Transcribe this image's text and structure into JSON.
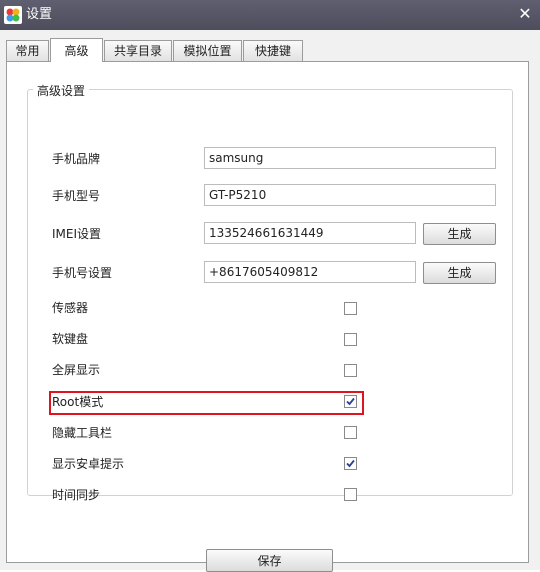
{
  "window": {
    "title": "设置"
  },
  "tabs": [
    {
      "label": "常用"
    },
    {
      "label": "高级"
    },
    {
      "label": "共享目录"
    },
    {
      "label": "模拟位置"
    },
    {
      "label": "快捷键"
    }
  ],
  "advanced": {
    "group_title": "高级设置",
    "brand": {
      "label": "手机品牌",
      "value": "samsung"
    },
    "model": {
      "label": "手机型号",
      "value": "GT-P5210"
    },
    "imei": {
      "label": "IMEI设置",
      "value": "133524661631449",
      "button": "生成"
    },
    "phone": {
      "label": "手机号设置",
      "value": "+8617605409812",
      "button": "生成"
    },
    "options": [
      {
        "label": "传感器",
        "checked": false
      },
      {
        "label": "软键盘",
        "checked": false
      },
      {
        "label": "全屏显示",
        "checked": false
      },
      {
        "label": "Root模式",
        "checked": true
      },
      {
        "label": "隐藏工具栏",
        "checked": false
      },
      {
        "label": "显示安卓提示",
        "checked": true
      },
      {
        "label": "时间同步",
        "checked": false
      }
    ]
  },
  "footer": {
    "save_label": "保存"
  },
  "colors": {
    "titlebar": "#55556a",
    "highlight": "#e0141e",
    "check": "#2a3f8f"
  }
}
